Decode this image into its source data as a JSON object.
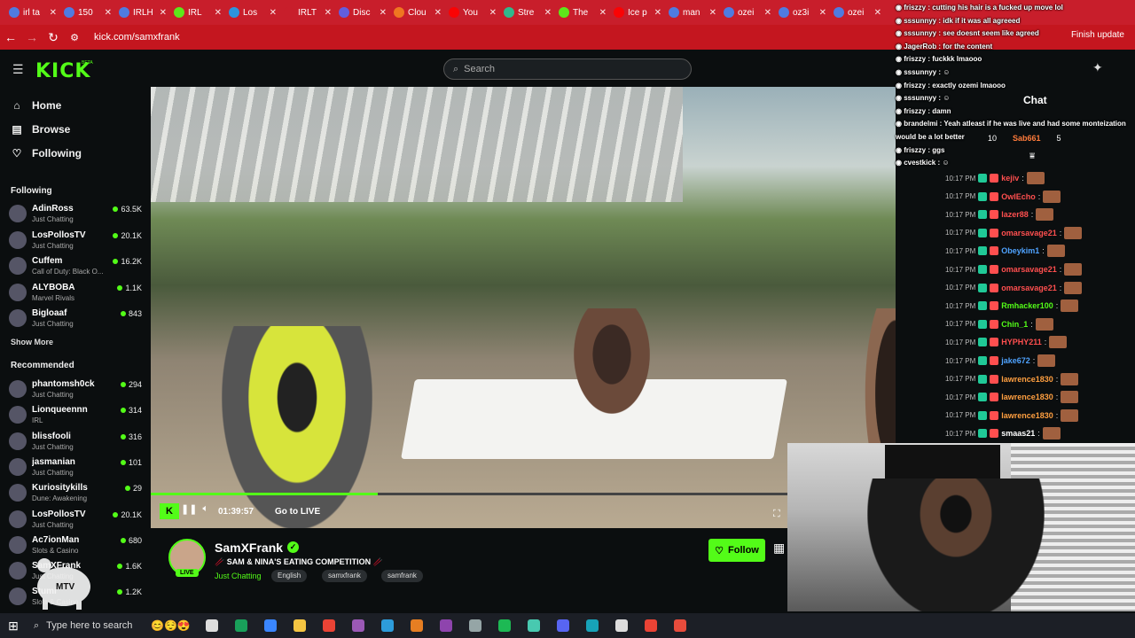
{
  "browser": {
    "tabs": [
      {
        "label": "irl ta",
        "color": "#4285f4"
      },
      {
        "label": "150",
        "color": "#4285f4"
      },
      {
        "label": "IRLH",
        "color": "#4285f4"
      },
      {
        "label": "IRL",
        "color": "#53fc18"
      },
      {
        "label": "Los",
        "color": "#1da1f2"
      },
      {
        "label": "IRLT",
        "color": "#c81e2b"
      },
      {
        "label": "Disc",
        "color": "#5865f2"
      },
      {
        "label": "Clou",
        "color": "#f38020"
      },
      {
        "label": "You",
        "color": "#ff0000"
      },
      {
        "label": "Stre",
        "color": "#20c997"
      },
      {
        "label": "The",
        "color": "#53fc18"
      },
      {
        "label": "Ice p",
        "color": "#ff0000"
      },
      {
        "label": "man",
        "color": "#4285f4"
      },
      {
        "label": "ozei",
        "color": "#4285f4"
      },
      {
        "label": "oz3i",
        "color": "#4285f4"
      },
      {
        "label": "ozei",
        "color": "#4285f4"
      }
    ],
    "url": "kick.com/samxfrank",
    "finish_update": "Finish update"
  },
  "kick": {
    "logo": "KICK",
    "beta": "BETA",
    "search_placeholder": "Search",
    "nav": [
      {
        "label": "Home",
        "icon": "home-icon",
        "glyph": "⌂"
      },
      {
        "label": "Browse",
        "icon": "browse-icon",
        "glyph": "▤"
      },
      {
        "label": "Following",
        "icon": "heart-icon",
        "glyph": "♡"
      }
    ],
    "following_title": "Following",
    "following": [
      {
        "name": "AdinRoss",
        "category": "Just Chatting",
        "viewers": "63.5K"
      },
      {
        "name": "LosPollosTV",
        "category": "Just Chatting",
        "viewers": "20.1K"
      },
      {
        "name": "Cuffem",
        "category": "Call of Duty: Black O...",
        "viewers": "16.2K"
      },
      {
        "name": "ALYBOBA",
        "category": "Marvel Rivals",
        "viewers": "1.1K"
      },
      {
        "name": "Bigloaaf",
        "category": "Just Chatting",
        "viewers": "843"
      }
    ],
    "show_more": "Show More",
    "recommended_title": "Recommended",
    "recommended": [
      {
        "name": "phantomsh0ck",
        "category": "Just Chatting",
        "viewers": "294"
      },
      {
        "name": "Lionqueennn",
        "category": "IRL",
        "viewers": "314"
      },
      {
        "name": "blissfooli",
        "category": "Just Chatting",
        "viewers": "316"
      },
      {
        "name": "jasmanian",
        "category": "Just Chatting",
        "viewers": "101"
      },
      {
        "name": "Kuriositykills",
        "category": "Dune: Awakening",
        "viewers": "29"
      },
      {
        "name": "LosPollosTV",
        "category": "Just Chatting",
        "viewers": "20.1K"
      },
      {
        "name": "Ac7ionMan",
        "category": "Slots & Casino",
        "viewers": "680"
      },
      {
        "name": "SamXFrank",
        "category": "Just Chatting",
        "viewers": "1.6K"
      },
      {
        "name": "Stumi",
        "category": "Slots & Casino",
        "viewers": "1.2K"
      }
    ],
    "player": {
      "progress": 0.356,
      "time": "01:39:57",
      "go_live": "Go to LIVE"
    },
    "channel": {
      "name": "SamXFrank",
      "live": "LIVE",
      "title": "🥢 SAM & NINA'S EATING COMPETITION 🥢",
      "category": "Just Chatting",
      "tags": [
        "English",
        "samxfrank",
        "samfrank"
      ],
      "follow": "Follow"
    },
    "chat": {
      "title": "Chat",
      "gift_counts": [
        "10",
        "Sab661",
        "5"
      ],
      "messages": [
        {
          "time": "10:17 PM",
          "user": "kejiv",
          "color": "#ff4f4f"
        },
        {
          "time": "10:17 PM",
          "user": "OwlEcho",
          "color": "#ff4f4f"
        },
        {
          "time": "10:17 PM",
          "user": "lazer88",
          "color": "#ff4f4f"
        },
        {
          "time": "10:17 PM",
          "user": "omarsavage21",
          "color": "#ff4f4f"
        },
        {
          "time": "10:17 PM",
          "user": "Obeykim1",
          "color": "#4fa3ff"
        },
        {
          "time": "10:17 PM",
          "user": "omarsavage21",
          "color": "#ff4f4f"
        },
        {
          "time": "10:17 PM",
          "user": "omarsavage21",
          "color": "#ff4f4f"
        },
        {
          "time": "10:17 PM",
          "user": "Rmhacker100",
          "color": "#53fc18"
        },
        {
          "time": "10:17 PM",
          "user": "Chin_1",
          "color": "#53fc18"
        },
        {
          "time": "10:17 PM",
          "user": "HYPHY211",
          "color": "#ff4f4f"
        },
        {
          "time": "10:17 PM",
          "user": "jake672",
          "color": "#4fa3ff"
        },
        {
          "time": "10:17 PM",
          "user": "lawrence1830",
          "color": "#ff9f40"
        },
        {
          "time": "10:17 PM",
          "user": "lawrence1830",
          "color": "#ff9f40"
        },
        {
          "time": "10:17 PM",
          "user": "lawrence1830",
          "color": "#ff9f40"
        },
        {
          "time": "10:17 PM",
          "user": "smaas21",
          "color": "#ffffff"
        }
      ]
    }
  },
  "overlay_chat": [
    {
      "user": "friszzy",
      "text": "cutting his hair is a fucked up move lol"
    },
    {
      "user": "sssunnyy",
      "text": "idk if it was all agreeed"
    },
    {
      "user": "sssunnyy",
      "text": "see doesnt seem like agreed"
    },
    {
      "user": "JagerRob",
      "text": "for the content"
    },
    {
      "user": "friszzy",
      "text": "fuckkk lmaooo"
    },
    {
      "user": "sssunnyy",
      "text": "☺"
    },
    {
      "user": "friszzy",
      "text": "exactly ozemi lmaooo"
    },
    {
      "user": "sssunnyy",
      "text": "☺"
    },
    {
      "user": "friszzy",
      "text": "damn"
    },
    {
      "user": "brandelmi",
      "text": "Yeah atleast if he was live and had some monteization"
    },
    {
      "user": "",
      "text": "would be a lot better"
    },
    {
      "user": "friszzy",
      "text": "ggs"
    },
    {
      "user": "cvestkick",
      "text": "☺"
    }
  ],
  "watermark": "MTV",
  "taskbar": {
    "search_placeholder": "Type here to search",
    "icons": [
      {
        "name": "task-view-icon",
        "color": "#ddd"
      },
      {
        "name": "app-green-icon",
        "color": "#19a05a"
      },
      {
        "name": "copilot-icon",
        "color": "#3a86ff"
      },
      {
        "name": "file-explorer-icon",
        "color": "#f5c542"
      },
      {
        "name": "chrome-icon",
        "color": "#ea4335"
      },
      {
        "name": "premiere-icon",
        "color": "#9b59b6"
      },
      {
        "name": "photoshop-icon",
        "color": "#2d9cdb"
      },
      {
        "name": "app-orange-icon",
        "color": "#e67e22"
      },
      {
        "name": "app-purple-icon",
        "color": "#8e44ad"
      },
      {
        "name": "app-gray-icon",
        "color": "#95a5a6"
      },
      {
        "name": "spotify-icon",
        "color": "#1db954"
      },
      {
        "name": "app-cyan-icon",
        "color": "#48c9b0"
      },
      {
        "name": "discord-icon",
        "color": "#5865f2"
      },
      {
        "name": "app-teal-icon",
        "color": "#17a2b8"
      },
      {
        "name": "app-white-icon",
        "color": "#dddddd"
      },
      {
        "name": "chrome-active-icon",
        "color": "#ea4335"
      },
      {
        "name": "app-red-icon",
        "color": "#e74c3c"
      }
    ]
  }
}
